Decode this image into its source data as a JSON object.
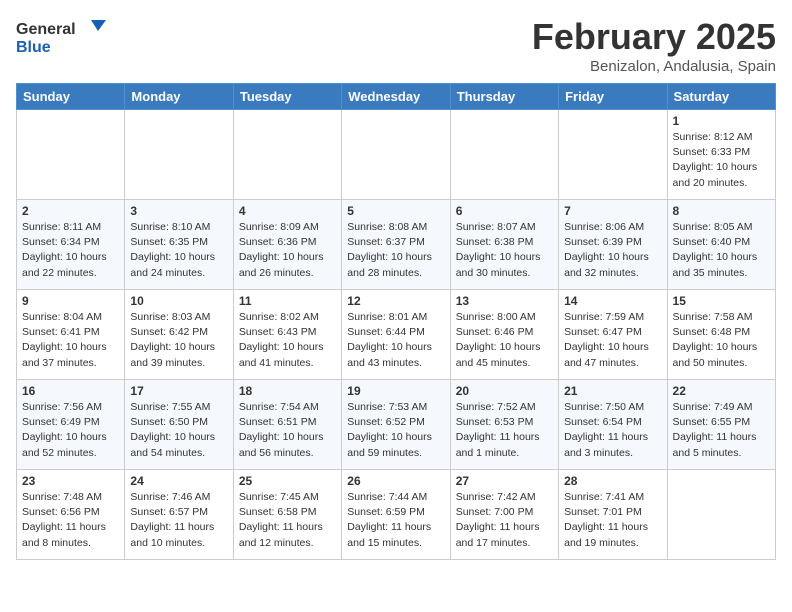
{
  "header": {
    "logo_general": "General",
    "logo_blue": "Blue",
    "month_title": "February 2025",
    "location": "Benizalon, Andalusia, Spain"
  },
  "weekdays": [
    "Sunday",
    "Monday",
    "Tuesday",
    "Wednesday",
    "Thursday",
    "Friday",
    "Saturday"
  ],
  "weeks": [
    [
      {
        "day": null
      },
      {
        "day": null
      },
      {
        "day": null
      },
      {
        "day": null
      },
      {
        "day": null
      },
      {
        "day": null
      },
      {
        "day": "1",
        "sunrise": "8:12 AM",
        "sunset": "6:33 PM",
        "daylight": "10 hours and 20 minutes."
      }
    ],
    [
      {
        "day": "2",
        "sunrise": "8:11 AM",
        "sunset": "6:34 PM",
        "daylight": "10 hours and 22 minutes."
      },
      {
        "day": "3",
        "sunrise": "8:10 AM",
        "sunset": "6:35 PM",
        "daylight": "10 hours and 24 minutes."
      },
      {
        "day": "4",
        "sunrise": "8:09 AM",
        "sunset": "6:36 PM",
        "daylight": "10 hours and 26 minutes."
      },
      {
        "day": "5",
        "sunrise": "8:08 AM",
        "sunset": "6:37 PM",
        "daylight": "10 hours and 28 minutes."
      },
      {
        "day": "6",
        "sunrise": "8:07 AM",
        "sunset": "6:38 PM",
        "daylight": "10 hours and 30 minutes."
      },
      {
        "day": "7",
        "sunrise": "8:06 AM",
        "sunset": "6:39 PM",
        "daylight": "10 hours and 32 minutes."
      },
      {
        "day": "8",
        "sunrise": "8:05 AM",
        "sunset": "6:40 PM",
        "daylight": "10 hours and 35 minutes."
      }
    ],
    [
      {
        "day": "9",
        "sunrise": "8:04 AM",
        "sunset": "6:41 PM",
        "daylight": "10 hours and 37 minutes."
      },
      {
        "day": "10",
        "sunrise": "8:03 AM",
        "sunset": "6:42 PM",
        "daylight": "10 hours and 39 minutes."
      },
      {
        "day": "11",
        "sunrise": "8:02 AM",
        "sunset": "6:43 PM",
        "daylight": "10 hours and 41 minutes."
      },
      {
        "day": "12",
        "sunrise": "8:01 AM",
        "sunset": "6:44 PM",
        "daylight": "10 hours and 43 minutes."
      },
      {
        "day": "13",
        "sunrise": "8:00 AM",
        "sunset": "6:46 PM",
        "daylight": "10 hours and 45 minutes."
      },
      {
        "day": "14",
        "sunrise": "7:59 AM",
        "sunset": "6:47 PM",
        "daylight": "10 hours and 47 minutes."
      },
      {
        "day": "15",
        "sunrise": "7:58 AM",
        "sunset": "6:48 PM",
        "daylight": "10 hours and 50 minutes."
      }
    ],
    [
      {
        "day": "16",
        "sunrise": "7:56 AM",
        "sunset": "6:49 PM",
        "daylight": "10 hours and 52 minutes."
      },
      {
        "day": "17",
        "sunrise": "7:55 AM",
        "sunset": "6:50 PM",
        "daylight": "10 hours and 54 minutes."
      },
      {
        "day": "18",
        "sunrise": "7:54 AM",
        "sunset": "6:51 PM",
        "daylight": "10 hours and 56 minutes."
      },
      {
        "day": "19",
        "sunrise": "7:53 AM",
        "sunset": "6:52 PM",
        "daylight": "10 hours and 59 minutes."
      },
      {
        "day": "20",
        "sunrise": "7:52 AM",
        "sunset": "6:53 PM",
        "daylight": "11 hours and 1 minute."
      },
      {
        "day": "21",
        "sunrise": "7:50 AM",
        "sunset": "6:54 PM",
        "daylight": "11 hours and 3 minutes."
      },
      {
        "day": "22",
        "sunrise": "7:49 AM",
        "sunset": "6:55 PM",
        "daylight": "11 hours and 5 minutes."
      }
    ],
    [
      {
        "day": "23",
        "sunrise": "7:48 AM",
        "sunset": "6:56 PM",
        "daylight": "11 hours and 8 minutes."
      },
      {
        "day": "24",
        "sunrise": "7:46 AM",
        "sunset": "6:57 PM",
        "daylight": "11 hours and 10 minutes."
      },
      {
        "day": "25",
        "sunrise": "7:45 AM",
        "sunset": "6:58 PM",
        "daylight": "11 hours and 12 minutes."
      },
      {
        "day": "26",
        "sunrise": "7:44 AM",
        "sunset": "6:59 PM",
        "daylight": "11 hours and 15 minutes."
      },
      {
        "day": "27",
        "sunrise": "7:42 AM",
        "sunset": "7:00 PM",
        "daylight": "11 hours and 17 minutes."
      },
      {
        "day": "28",
        "sunrise": "7:41 AM",
        "sunset": "7:01 PM",
        "daylight": "11 hours and 19 minutes."
      },
      {
        "day": null
      }
    ]
  ]
}
